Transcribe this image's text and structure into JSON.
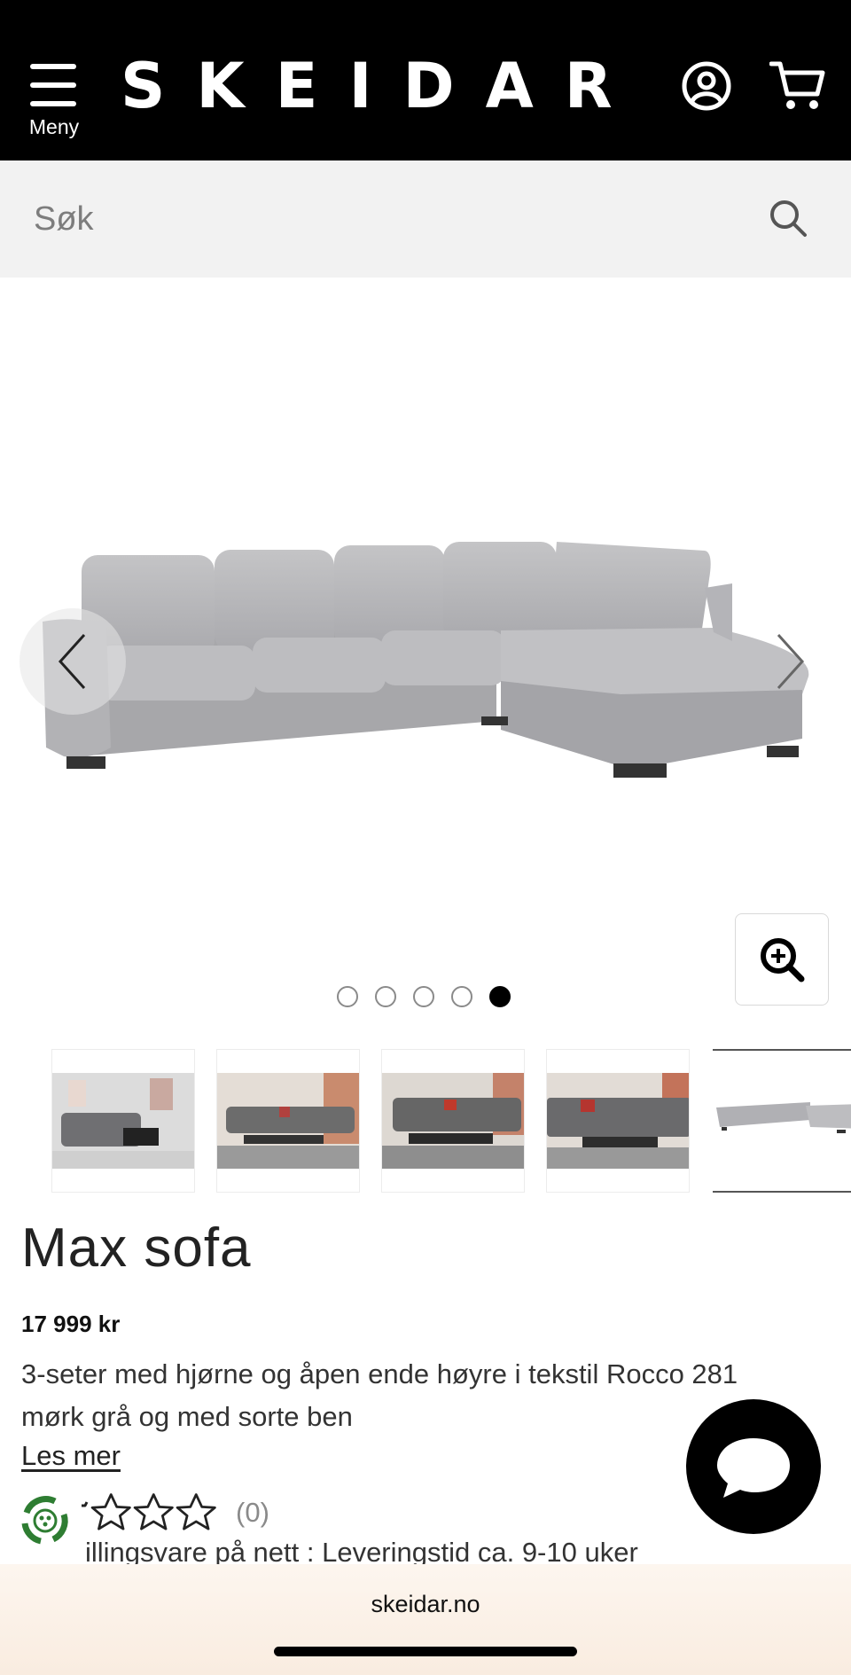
{
  "header": {
    "menu_label": "Meny",
    "logo": "SKEIDAR",
    "account_icon": "user-circle-icon",
    "cart_icon": "cart-icon",
    "background": "#000000"
  },
  "search": {
    "placeholder": "Søk",
    "icon": "search-icon"
  },
  "gallery": {
    "image_count": 5,
    "active_index": 4,
    "prev_icon": "chevron-left-icon",
    "next_icon": "chevron-right-icon",
    "zoom_icon": "zoom-in-icon",
    "thumbnails": [
      {
        "alt": "living-room-1"
      },
      {
        "alt": "living-room-2"
      },
      {
        "alt": "living-room-3"
      },
      {
        "alt": "living-room-4"
      },
      {
        "alt": "sofa-product"
      }
    ]
  },
  "product": {
    "title": "Max sofa",
    "price": "17 999 kr",
    "description": "3-seter med hjørne og åpen ende høyre i tekstil Rocco 281 mørk grå og med sorte ben",
    "read_more": "Les mer",
    "rating_stars": 0,
    "review_count": "(0)",
    "delivery_text": "illingsvare på nett : Leveringstid ca. 9-10 uker"
  },
  "chat": {
    "icon": "chat-bubble-icon"
  },
  "browser": {
    "url": "skeidar.no"
  },
  "colors": {
    "accent": "#000000",
    "search_bg": "#f2f2f2",
    "eco_green": "#2e7d32"
  }
}
